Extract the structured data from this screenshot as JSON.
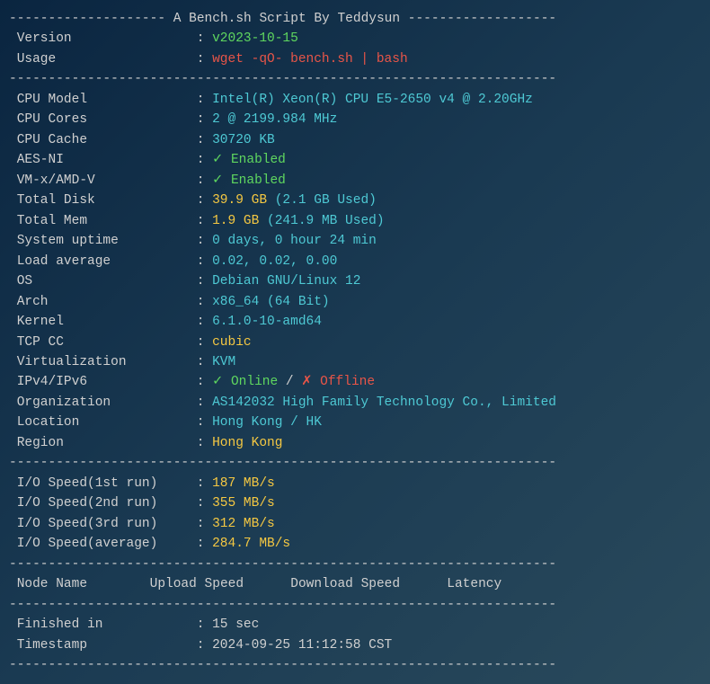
{
  "title_dashes_left": "-------------------- ",
  "title_text": "A Bench.sh Script By Teddysun",
  "title_dashes_right": " -------------------",
  "version": {
    "label": " Version",
    "value": "v2023-10-15"
  },
  "usage": {
    "label": " Usage",
    "value": "wget -qO- bench.sh | bash"
  },
  "divider": "----------------------------------------------------------------------",
  "cpu_model": {
    "label": " CPU Model",
    "value": "Intel(R) Xeon(R) CPU E5-2650 v4 @ 2.20GHz"
  },
  "cpu_cores": {
    "label": " CPU Cores",
    "value": "2 @ 2199.984 MHz"
  },
  "cpu_cache": {
    "label": " CPU Cache",
    "value": "30720 KB"
  },
  "aes_ni": {
    "label": " AES-NI",
    "check": "✓ ",
    "value": "Enabled"
  },
  "vmx": {
    "label": " VM-x/AMD-V",
    "check": "✓ ",
    "value": "Enabled"
  },
  "total_disk": {
    "label": " Total Disk",
    "value": "39.9 GB",
    "used": " (2.1 GB Used)"
  },
  "total_mem": {
    "label": " Total Mem",
    "value": "1.9 GB",
    "used": " (241.9 MB Used)"
  },
  "uptime": {
    "label": " System uptime",
    "value": "0 days, 0 hour 24 min"
  },
  "load": {
    "label": " Load average",
    "value": "0.02, 0.02, 0.00"
  },
  "os": {
    "label": " OS",
    "value": "Debian GNU/Linux 12"
  },
  "arch": {
    "label": " Arch",
    "value": "x86_64 (64 Bit)"
  },
  "kernel": {
    "label": " Kernel",
    "value": "6.1.0-10-amd64"
  },
  "tcp_cc": {
    "label": " TCP CC",
    "value": "cubic"
  },
  "virt": {
    "label": " Virtualization",
    "value": "KVM"
  },
  "ipv": {
    "label": " IPv4/IPv6",
    "v4check": "✓ ",
    "v4": "Online",
    "sep": " / ",
    "v6check": "✗ ",
    "v6": "Offline"
  },
  "org": {
    "label": " Organization",
    "value": "AS142032 High Family Technology Co., Limited"
  },
  "location": {
    "label": " Location",
    "value": "Hong Kong / HK"
  },
  "region": {
    "label": " Region",
    "value": "Hong Kong"
  },
  "io1": {
    "label": " I/O Speed(1st run)",
    "value": "187 MB/s"
  },
  "io2": {
    "label": " I/O Speed(2nd run)",
    "value": "355 MB/s"
  },
  "io3": {
    "label": " I/O Speed(3rd run)",
    "value": "312 MB/s"
  },
  "ioavg": {
    "label": " I/O Speed(average)",
    "value": "284.7 MB/s"
  },
  "table_header": " Node Name        Upload Speed      Download Speed      Latency     ",
  "finished": {
    "label": " Finished in",
    "value": "15 sec"
  },
  "timestamp": {
    "label": " Timestamp",
    "value": "2024-09-25 11:12:58 CST"
  }
}
